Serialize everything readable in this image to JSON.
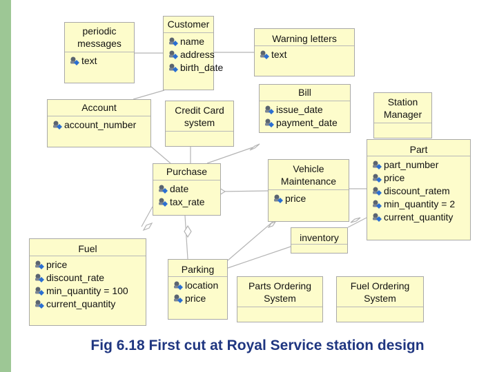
{
  "caption": "Fig 6.18 First cut at Royal Service station design",
  "icons": {
    "attribute": "attribute-key-icon"
  },
  "colors": {
    "class_fill": "#fdfccb",
    "class_border": "#a8a8a8",
    "caption": "#1f3680",
    "side_bar": "#9dc795"
  },
  "classes": {
    "periodic_messages": {
      "name": "periodic\nmessages",
      "attributes": [
        "text"
      ]
    },
    "customer": {
      "name": "Customer",
      "attributes": [
        "name",
        "address",
        "birth_date"
      ]
    },
    "warning_letters": {
      "name": "Warning letters",
      "attributes": [
        "text"
      ]
    },
    "account": {
      "name": "Account",
      "attributes": [
        "account_number"
      ]
    },
    "credit_card_system": {
      "name": "Credit Card\nsystem",
      "attributes": []
    },
    "bill": {
      "name": "Bill",
      "attributes": [
        "issue_date",
        "payment_date"
      ]
    },
    "station_manager": {
      "name": "Station\nManager",
      "attributes": []
    },
    "purchase": {
      "name": "Purchase",
      "attributes": [
        "date",
        "tax_rate"
      ]
    },
    "vehicle_maintenance": {
      "name": "Vehicle\nMaintenance",
      "attributes": [
        "price"
      ]
    },
    "part": {
      "name": "Part",
      "attributes": [
        "part_number",
        "price",
        "discount_ratem",
        "min_quantity = 2",
        "current_quantity"
      ]
    },
    "fuel": {
      "name": "Fuel",
      "attributes": [
        "price",
        "discount_rate",
        "min_quantity = 100",
        "current_quantity"
      ]
    },
    "inventory": {
      "name": "inventory",
      "attributes": []
    },
    "parking": {
      "name": "Parking",
      "attributes": [
        "location",
        "price"
      ]
    },
    "parts_ordering_system": {
      "name": "Parts Ordering\nSystem",
      "attributes": []
    },
    "fuel_ordering_system": {
      "name": "Fuel Ordering\nSystem",
      "attributes": []
    }
  }
}
